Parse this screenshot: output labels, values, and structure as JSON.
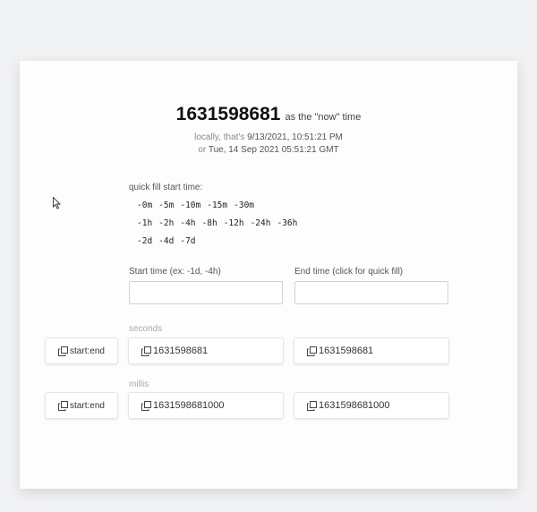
{
  "header": {
    "timestamp": "1631598681",
    "suffix": "as the \"now\" time",
    "local_prefix": "locally, that's ",
    "local_value": "9/13/2021, 10:51:21 PM",
    "gmt_prefix": "or ",
    "gmt_value": "Tue, 14 Sep 2021 05:51:21 GMT"
  },
  "quick_fill": {
    "label": "quick fill start time:",
    "rows": [
      [
        "-0m",
        "-5m",
        "-10m",
        "-15m",
        "-30m"
      ],
      [
        "-1h",
        "-2h",
        "-4h",
        "-8h",
        "-12h",
        "-24h",
        "-36h"
      ],
      [
        "-2d",
        "-4d",
        "-7d"
      ]
    ]
  },
  "inputs": {
    "start_label": "Start time (ex: -1d, -4h)",
    "start_value": "",
    "end_label": "End time (click for quick fill)",
    "end_value": ""
  },
  "seconds": {
    "label": "seconds",
    "range_button": "start:end",
    "start_value": "1631598681",
    "end_value": "1631598681"
  },
  "millis": {
    "label": "millis",
    "range_button": "start:end",
    "start_value": "1631598681000",
    "end_value": "1631598681000"
  },
  "icons": {
    "copy": "copy-icon",
    "cursor": "mouse-pointer"
  }
}
